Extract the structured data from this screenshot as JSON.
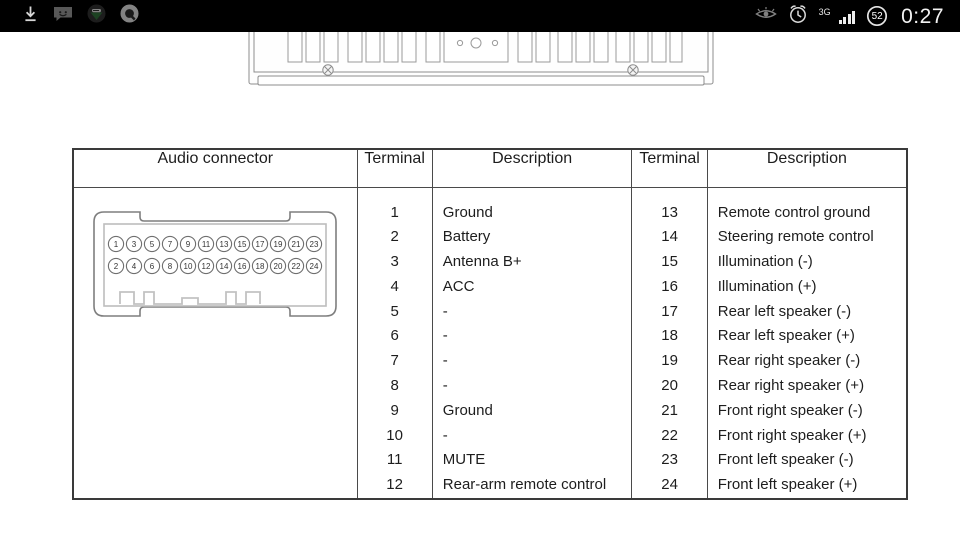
{
  "statusbar": {
    "left_icons": [
      {
        "name": "download-icon",
        "label": "Download"
      },
      {
        "name": "message-icon",
        "label": "Messaging"
      },
      {
        "name": "app-green-icon",
        "label": "App notification"
      },
      {
        "name": "app-circle-icon",
        "label": "App notification"
      }
    ],
    "right_icons": [
      {
        "name": "eye-icon",
        "label": "Eye"
      },
      {
        "name": "alarm-clock-icon",
        "label": "Alarm"
      }
    ],
    "network_label": "3G",
    "signal_bars": 4,
    "battery_level": "52",
    "time": "0:27",
    "background_color": "#000000"
  },
  "illustration": {
    "name": "car-stereo-rear-panel",
    "caption": ""
  },
  "table": {
    "headers": {
      "connector": "Audio connector",
      "terminal_left": "Terminal",
      "description_left": "Description",
      "terminal_right": "Terminal",
      "description_right": "Description"
    },
    "connector": {
      "name": "24-pin-audio-connector",
      "top_row_pins": [
        "1",
        "3",
        "5",
        "7",
        "9",
        "11",
        "13",
        "15",
        "17",
        "19",
        "21",
        "23"
      ],
      "bottom_row_pins": [
        "2",
        "4",
        "6",
        "8",
        "10",
        "12",
        "14",
        "16",
        "18",
        "20",
        "22",
        "24"
      ]
    },
    "left_terminals": [
      "1",
      "2",
      "3",
      "4",
      "5",
      "6",
      "7",
      "8",
      "9",
      "10",
      "11",
      "12"
    ],
    "left_descriptions": [
      "Ground",
      "Battery",
      "Antenna B+",
      "ACC",
      "-",
      "-",
      "-",
      "-",
      "Ground",
      "-",
      "MUTE",
      "Rear-arm remote control"
    ],
    "right_terminals": [
      "13",
      "14",
      "15",
      "16",
      "17",
      "18",
      "19",
      "20",
      "21",
      "22",
      "23",
      "24"
    ],
    "right_descriptions": [
      "Remote control ground",
      "Steering remote control",
      "Illumination (-)",
      "Illumination (+)",
      "Rear left speaker (-)",
      "Rear left speaker (+)",
      "Rear right speaker (-)",
      "Rear right speaker (+)",
      "Front right speaker (-)",
      "Front right speaker (+)",
      "Front left speaker (-)",
      "Front left speaker (+)"
    ]
  },
  "colors": {
    "page_background": "#ffffff",
    "table_border": "#3a3a3a",
    "text": "#1d1d1d",
    "statusbar_background": "#000000"
  }
}
